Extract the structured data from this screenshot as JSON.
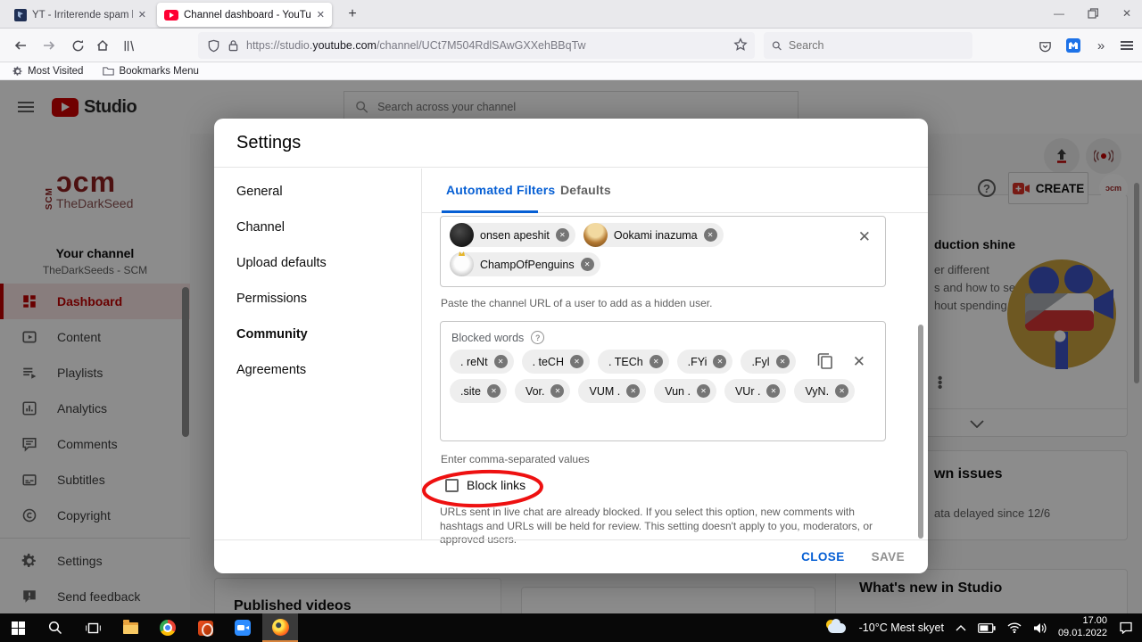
{
  "browser": {
    "tabs": [
      {
        "title": "YT - Irriterende spam boter - Int"
      },
      {
        "title": "Channel dashboard - YouTube S"
      }
    ],
    "url": {
      "prefix": "https://studio.",
      "domain": "youtube.com",
      "path": "/channel/UCt7M504RdlSAwGXXehBBqTw"
    },
    "search_placeholder": "Search",
    "bookmarks": {
      "most_visited": "Most Visited",
      "menu": "Bookmarks Menu"
    }
  },
  "studio": {
    "brand": "Studio",
    "search_placeholder": "Search across your channel",
    "create_label": "CREATE",
    "channel_logo": {
      "vertical": "SCM",
      "main": "ɔcm",
      "sub": "TheDarkSeed",
      "avatar": "ɔcm"
    },
    "your_channel_label": "Your channel",
    "channel_name": "TheDarkSeeds - SCM",
    "sidebar_items": [
      {
        "label": "Dashboard"
      },
      {
        "label": "Content"
      },
      {
        "label": "Playlists"
      },
      {
        "label": "Analytics"
      },
      {
        "label": "Comments"
      },
      {
        "label": "Subtitles"
      },
      {
        "label": "Copyright"
      },
      {
        "label": "Settings"
      },
      {
        "label": "Send feedback"
      }
    ],
    "background_fragments": {
      "card1_title": "duction shine",
      "card1_line1": "er different",
      "card1_line2": "s and how to set",
      "card1_line3": "hout spending a",
      "known_issues": "wn issues",
      "data_delayed": "ata delayed since 12/6",
      "whats_new": "What's new in Studio",
      "published_videos": "Published videos"
    }
  },
  "dialog": {
    "title": "Settings",
    "nav": [
      "General",
      "Channel",
      "Upload defaults",
      "Permissions",
      "Community",
      "Agreements"
    ],
    "tabs": {
      "automated": "Automated Filters",
      "defaults": "Defaults"
    },
    "hidden_users": {
      "chips": [
        {
          "name": "onsen apeshit"
        },
        {
          "name": "Ookami inazuma"
        },
        {
          "name": "ChampOfPenguins"
        }
      ],
      "helper": "Paste the channel URL of a user to add as a hidden user."
    },
    "blocked_words": {
      "label": "Blocked words",
      "row1": [
        ". reNt",
        ". teCH",
        ". TECh",
        ".FYi",
        ".Fyl"
      ],
      "row2": [
        ".site",
        "Vor.",
        "VUM .",
        "Vun .",
        "VUr .",
        "VyN."
      ],
      "helper": "Enter comma-separated values"
    },
    "block_links": {
      "label": "Block links",
      "checked": false,
      "description": "URLs sent in live chat are already blocked. If you select this option, new comments with hashtags and URLs will be held for review. This setting doesn't apply to you, moderators, or approved users."
    },
    "footer": {
      "close": "CLOSE",
      "save": "SAVE"
    }
  },
  "taskbar": {
    "weather": "-10°C Mest skyet",
    "time": "17.00",
    "date": "09.01.2022"
  },
  "colors": {
    "accent_blue": "#065fd4",
    "youtube_red": "#c00000",
    "annotation_red": "#ee1111"
  }
}
